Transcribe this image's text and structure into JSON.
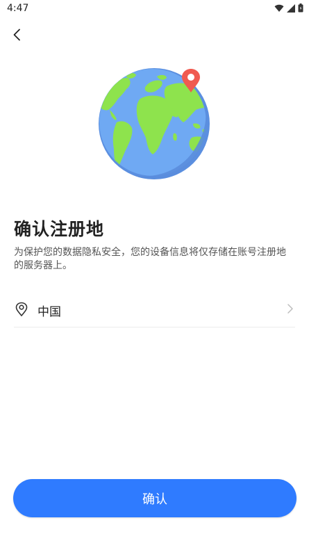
{
  "status_bar": {
    "time": "4:47",
    "icons": [
      "wifi-icon",
      "signal-icon",
      "battery-icon"
    ]
  },
  "header": {
    "back_icon": "chevron-left-icon"
  },
  "illustration": {
    "icon": "globe-icon",
    "pin_icon": "location-pin-icon"
  },
  "main": {
    "title": "确认注册地",
    "description": "为保护您的数据隐私安全，您的设备信息将仅存储在账号注册地的服务器上。"
  },
  "region": {
    "icon": "location-icon",
    "label": "中国",
    "chevron_icon": "chevron-right-icon"
  },
  "footer": {
    "confirm_label": "确认"
  },
  "colors": {
    "accent": "#2f7bff",
    "globe_ocean": "#6aa5f0",
    "globe_land": "#8ee34d",
    "pin": "#f05a50"
  }
}
